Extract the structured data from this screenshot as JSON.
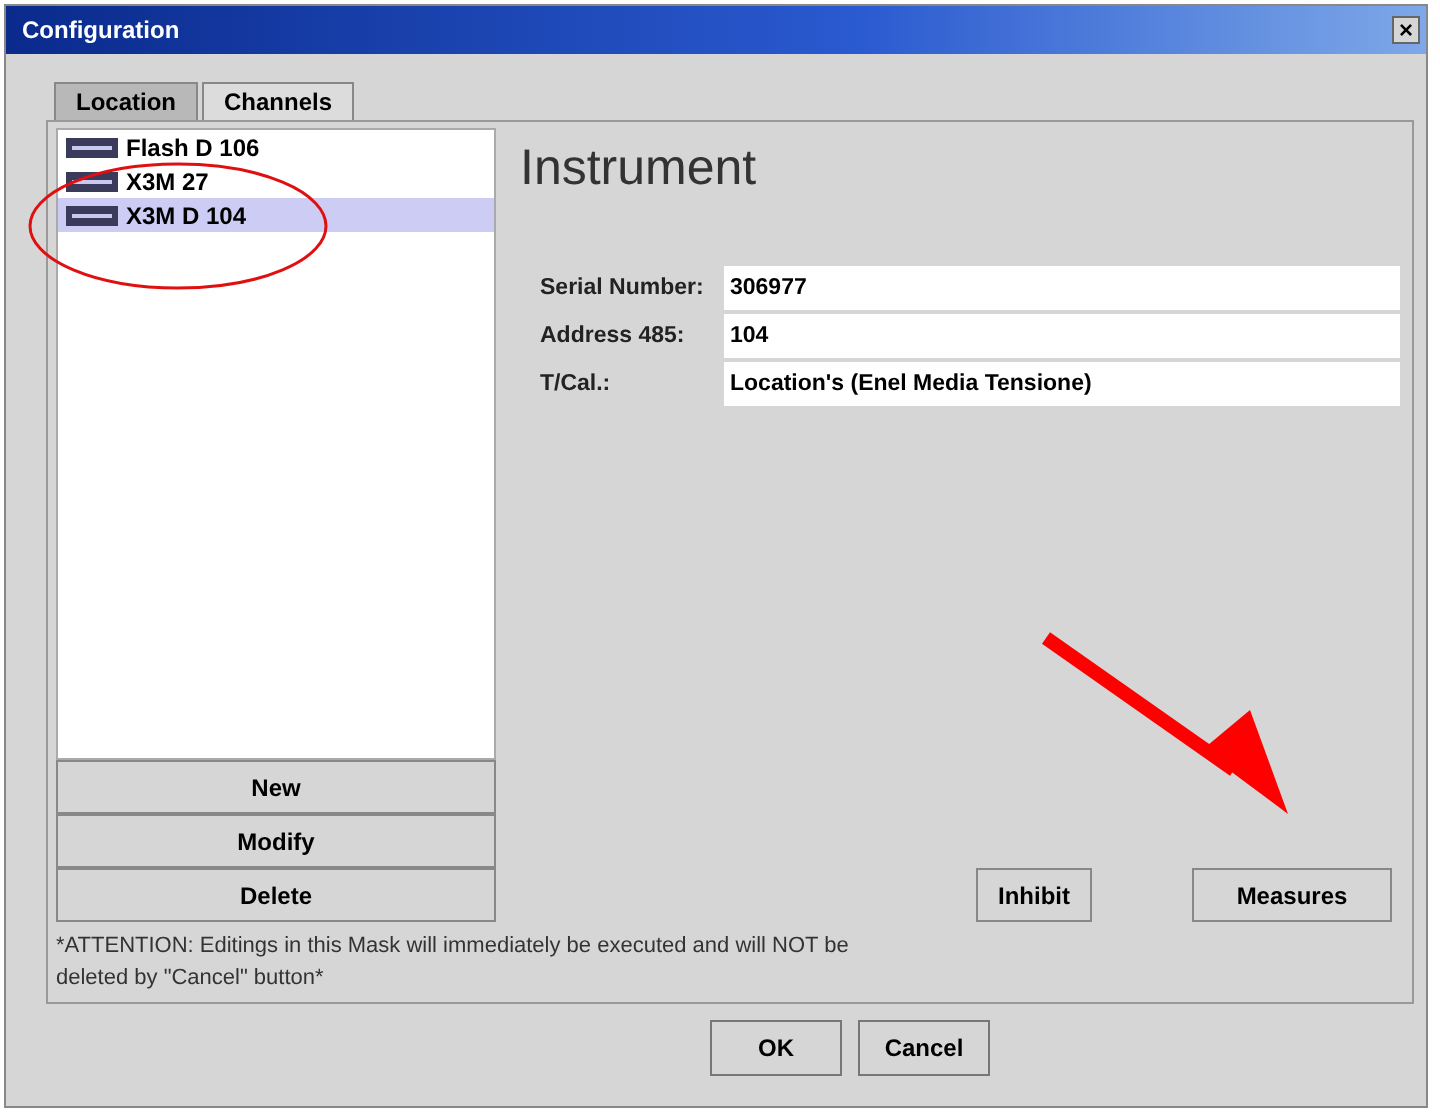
{
  "window": {
    "title": "Configuration",
    "close": "×"
  },
  "tabs": [
    {
      "label": "Location",
      "selected": true
    },
    {
      "label": "Channels",
      "selected": false
    }
  ],
  "list": [
    {
      "label": "Flash D 106",
      "selected": false
    },
    {
      "label": "X3M 27",
      "selected": false
    },
    {
      "label": "X3M D 104",
      "selected": true
    }
  ],
  "list_buttons": [
    "New",
    "Modify",
    "Delete"
  ],
  "instrument": {
    "title": "Instrument",
    "fields": [
      {
        "label": "Serial Number:",
        "value": "306977"
      },
      {
        "label": "Address 485:",
        "value": "104"
      },
      {
        "label": "T/Cal.:",
        "value": "Location's (Enel Media Tensione)"
      }
    ],
    "buttons": [
      "Inhibit",
      "Measures"
    ]
  },
  "note": "*ATTENTION: Editings in this Mask will immediately be executed and will NOT be deleted by \"Cancel\" button*",
  "dialog_buttons": [
    "OK",
    "Cancel"
  ]
}
